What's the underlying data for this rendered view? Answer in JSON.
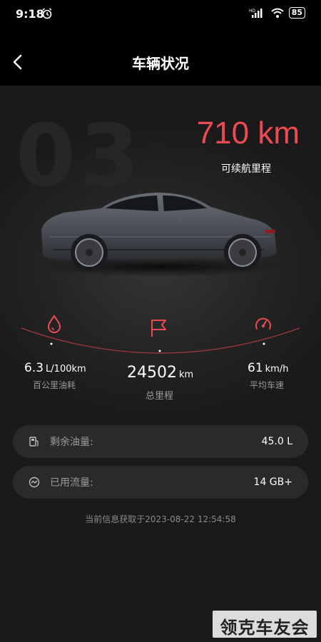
{
  "status_bar": {
    "time": "9:18",
    "network_label": "HD",
    "battery": "85"
  },
  "header": {
    "title": "车辆状况"
  },
  "range": {
    "background_number": "03",
    "value": "710 km",
    "label": "可续航里程"
  },
  "stats": {
    "fuel_consumption": {
      "value": "6.3",
      "unit": "L/100km",
      "label": "百公里油耗",
      "icon": "fuel-drop-icon"
    },
    "odometer": {
      "value": "24502",
      "unit": "km",
      "label": "总里程",
      "icon": "flag-icon"
    },
    "average_speed": {
      "value": "61",
      "unit": "km/h",
      "label": "平均车速",
      "icon": "speedometer-icon"
    }
  },
  "info": {
    "remaining_fuel": {
      "label": "剩余油量:",
      "value": "45.0 L",
      "icon": "fuel-pump-icon"
    },
    "data_used": {
      "label": "已用流量:",
      "value": "14 GB+",
      "icon": "traffic-gauge-icon"
    }
  },
  "timestamp": "当前信息获取于2023-08-22 12:54:58",
  "watermark": "领克车友会",
  "colors": {
    "accent": "#ef4a54",
    "background": "#1a1a1a",
    "card": "#2a2a2a",
    "muted_text": "#9a9a9a"
  }
}
